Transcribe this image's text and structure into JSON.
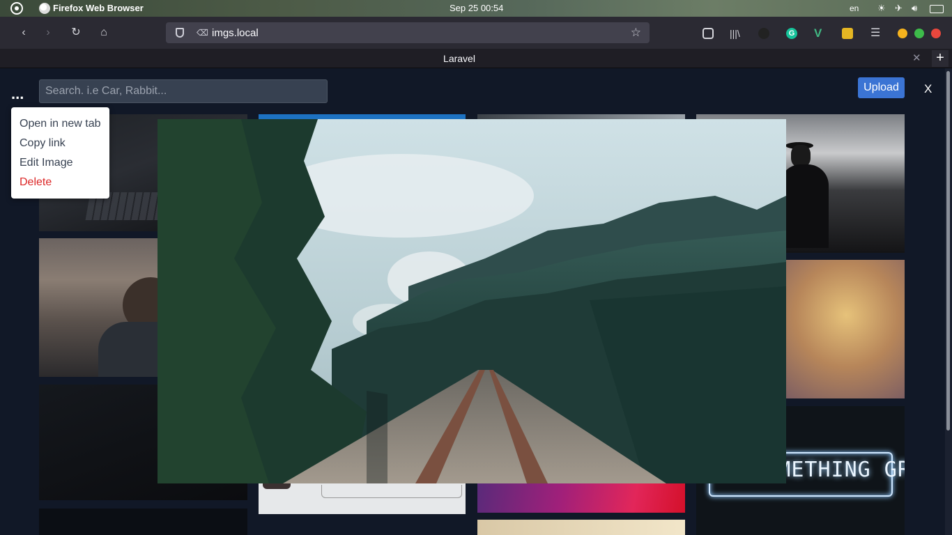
{
  "os": {
    "app_name": "Firefox Web Browser",
    "clock": "Sep 25  00:54",
    "lang": "en"
  },
  "browser": {
    "url": "imgs.local",
    "tab_title": "Laravel",
    "extensions": [
      "pocket-icon",
      "library-icon",
      "extension-icon",
      "grammarly-icon",
      "vue-devtools-icon",
      "color-picker-icon"
    ]
  },
  "page": {
    "menu_trigger": "...",
    "search_placeholder": "Search. i.e Car, Rabbit...",
    "upload_label": "Upload",
    "close_label": "X",
    "context_menu": {
      "open_new_tab": "Open in new tab",
      "copy_link": "Copy link",
      "edit_image": "Edit Image",
      "delete": "Delete"
    },
    "neon_sign_text": "DO SOMETHING GREAT"
  },
  "colors": {
    "page_bg": "#111827",
    "upload_bg": "#3b74d4",
    "delete_text": "#dc2626"
  }
}
